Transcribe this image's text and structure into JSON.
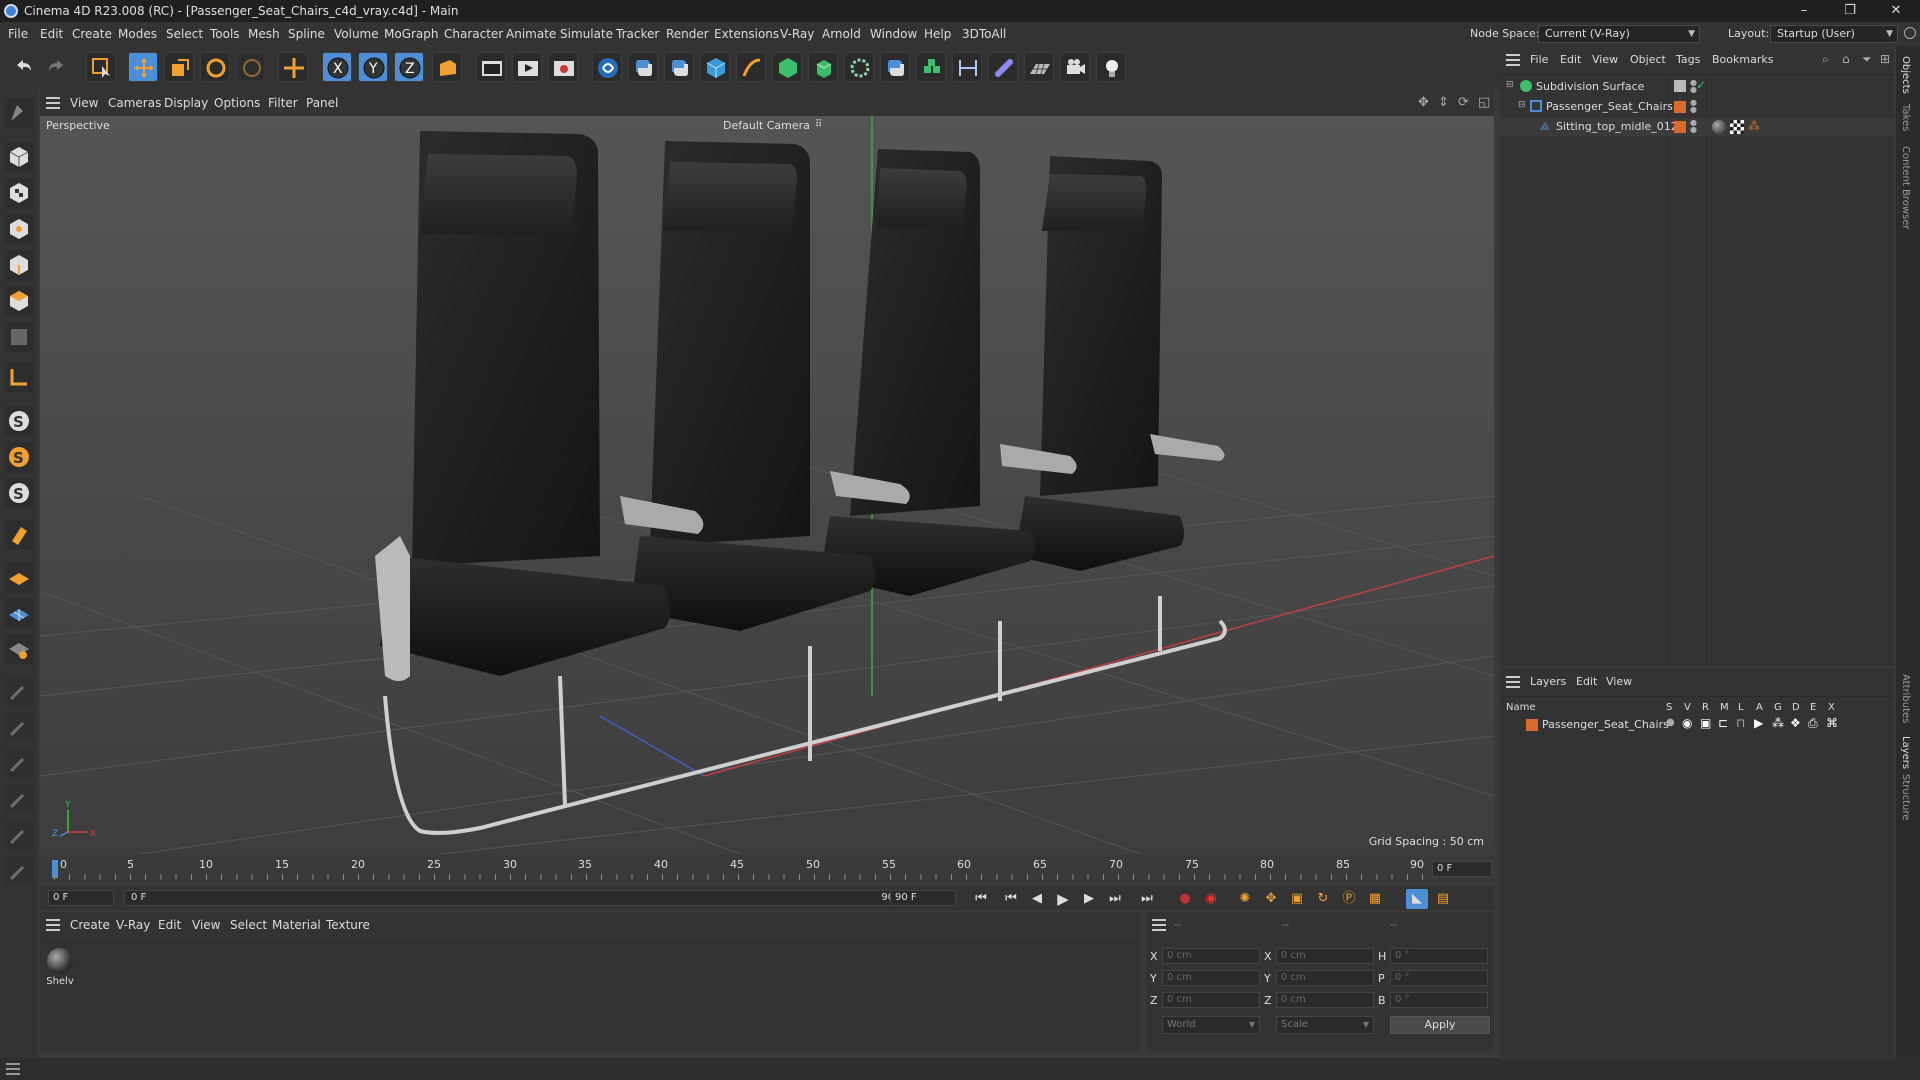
{
  "window": {
    "title": "Cinema 4D R23.008 (RC) - [Passenger_Seat_Chairs_c4d_vray.c4d] - Main",
    "minimize": "–",
    "restore": "❐",
    "close": "✕"
  },
  "menu": [
    "File",
    "Edit",
    "Create",
    "Modes",
    "Select",
    "Tools",
    "Mesh",
    "Spline",
    "Volume",
    "MoGraph",
    "Character",
    "Animate",
    "Simulate",
    "Tracker",
    "Render",
    "Extensions",
    "V-Ray",
    "Arnold",
    "Window",
    "Help",
    "3DToAll"
  ],
  "nodespace": {
    "label": "Node Space:",
    "value": "Current (V-Ray)"
  },
  "layout": {
    "label": "Layout:",
    "value": "Startup (User)"
  },
  "viewport_menu": [
    "View",
    "Cameras",
    "Display",
    "Options",
    "Filter",
    "Panel"
  ],
  "viewport": {
    "name": "Perspective",
    "camera": "Default Camera",
    "camera_icon": "⠿",
    "grid_spacing": "Grid Spacing : 50 cm",
    "axis": {
      "x": "X",
      "y": "Y",
      "z": "Z"
    }
  },
  "timeline": {
    "ticks": [
      "0",
      "5",
      "10",
      "15",
      "20",
      "25",
      "30",
      "35",
      "40",
      "45",
      "50",
      "55",
      "60",
      "65",
      "70",
      "75",
      "80",
      "85",
      "90"
    ],
    "current_frame": "0 F"
  },
  "frameinfo": {
    "start": "0 F",
    "current": "0 F",
    "end_slider": "90 F",
    "end": "90 F"
  },
  "material_menu": [
    "Create",
    "V-Ray",
    "Edit",
    "View",
    "Select",
    "Material",
    "Texture"
  ],
  "materials": [
    {
      "name": "Shelv"
    }
  ],
  "coords": {
    "header": [
      "--",
      "--",
      "--"
    ],
    "rows": [
      {
        "a": "X",
        "v1": "0 cm",
        "b": "X",
        "v2": "0 cm",
        "c": "H",
        "v3": "0 °"
      },
      {
        "a": "Y",
        "v1": "0 cm",
        "b": "Y",
        "v2": "0 cm",
        "c": "P",
        "v3": "0 °"
      },
      {
        "a": "Z",
        "v1": "0 cm",
        "b": "Z",
        "v2": "0 cm",
        "c": "B",
        "v3": "0 °"
      }
    ],
    "world": "World",
    "scale": "Scale",
    "apply": "Apply"
  },
  "objects_menu": [
    "File",
    "Edit",
    "View",
    "Object",
    "Tags",
    "Bookmarks"
  ],
  "objects": [
    {
      "name": "Subdivision Surface"
    },
    {
      "name": "Passenger_Seat_Chairs"
    },
    {
      "name": "Sitting_top_midle_012"
    }
  ],
  "layers_menu": [
    "Layers",
    "Edit",
    "View"
  ],
  "layers_header": {
    "name": "Name",
    "flags": [
      "S",
      "V",
      "R",
      "M",
      "L",
      "A",
      "G",
      "D",
      "E",
      "X"
    ]
  },
  "layers": [
    {
      "name": "Passenger_Seat_Chairs",
      "color": "#d9692c"
    }
  ],
  "side_tabs": [
    "Objects",
    "Takes",
    "Content Browser",
    "Attributes",
    "Layers",
    "Structure"
  ],
  "colors": {
    "accent": "#4d8fd6",
    "layer_orange": "#d9692c",
    "x_axis": "#d04040",
    "y_axis": "#40c040"
  }
}
